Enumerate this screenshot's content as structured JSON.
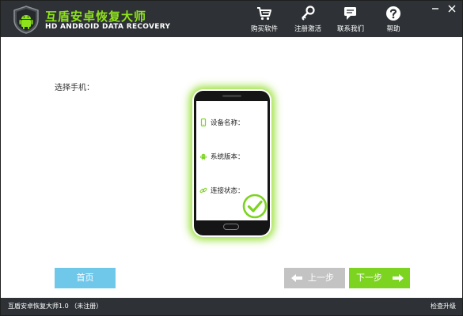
{
  "app": {
    "title": "互盾安卓恢复大师",
    "subtitle": "HD ANDROID DATA RECOVERY"
  },
  "toolbar": {
    "buy_label": "购买软件",
    "register_label": "注册激活",
    "contact_label": "联系我们",
    "help_label": "帮助"
  },
  "main": {
    "select_phone_label": "选择手机："
  },
  "phone": {
    "device_name_label": "设备名称：",
    "system_version_label": "系统版本：",
    "connection_status_label": "连接状态："
  },
  "buttons": {
    "home_label": "首页",
    "prev_label": "上一步",
    "next_label": "下一步"
  },
  "status": {
    "version_text": "互盾安卓恢复大师1.0 （未注册）",
    "check_update_label": "检查升级"
  },
  "colors": {
    "accent_green": "#7cd320",
    "title_green": "#8fe31a",
    "home_blue": "#6fc7ea",
    "disabled_gray": "#c3c3c3",
    "titlebar_dark": "#2e3236"
  },
  "icons": {
    "logo": "android-shield-logo-icon",
    "buy": "shopping-cart-icon",
    "register": "key-icon",
    "contact": "chat-icon",
    "help": "question-icon",
    "device": "phone-icon",
    "system": "android-icon",
    "connection": "link-icon",
    "status_ok": "check-circle-icon",
    "prev": "arrow-left-icon",
    "next": "arrow-right-icon"
  }
}
